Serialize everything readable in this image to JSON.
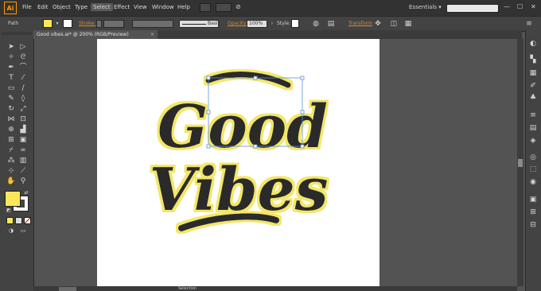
{
  "app": {
    "logo": "Ai"
  },
  "menu": [
    "File",
    "Edit",
    "Object",
    "Type",
    "Select",
    "Effect",
    "View",
    "Window",
    "Help"
  ],
  "menu_active": "Select",
  "workspace": {
    "label": "Essentials",
    "arrow": "▾"
  },
  "control": {
    "object_type": "Path",
    "stroke_label": "Stroke:",
    "brush_label": "Basic",
    "opacity_label": "Opacity:",
    "opacity_value": "100%",
    "style_label": "Style:",
    "transform_label": "Transform"
  },
  "document": {
    "tab_title": "Good vibes.ai* @ 200% (RGB/Preview)",
    "close": "×"
  },
  "artwork": {
    "line1": "Good",
    "line2": "Vibes"
  },
  "status": {
    "label": "Selection"
  },
  "colors": {
    "fill": "#f9e95a",
    "accent": "#d48a3a",
    "background": "#535353"
  },
  "icons": {
    "tools": [
      "selection-icon",
      "direct-selection-icon",
      "magic-wand-icon",
      "lasso-icon",
      "pen-icon",
      "curvature-icon",
      "type-icon",
      "line-icon",
      "rectangle-icon",
      "paintbrush-icon",
      "pencil-icon",
      "eraser-icon",
      "rotate-icon",
      "scale-icon",
      "width-icon",
      "free-transform-icon",
      "shape-builder-icon",
      "perspective-icon",
      "mesh-icon",
      "gradient-icon",
      "eyedropper-icon",
      "blend-icon",
      "symbol-sprayer-icon",
      "graph-icon",
      "artboard-icon",
      "slice-icon",
      "hand-icon",
      "zoom-icon"
    ],
    "right": [
      "color-icon",
      "color-guide-icon",
      "swatches-icon",
      "brushes-icon",
      "symbols-icon",
      "stroke-icon",
      "gradient-panel-icon",
      "transparency-icon",
      "appearance-icon",
      "graphic-styles-icon",
      "layers-icon",
      "artboards-panel-icon",
      "links-icon",
      "align-icon"
    ]
  }
}
